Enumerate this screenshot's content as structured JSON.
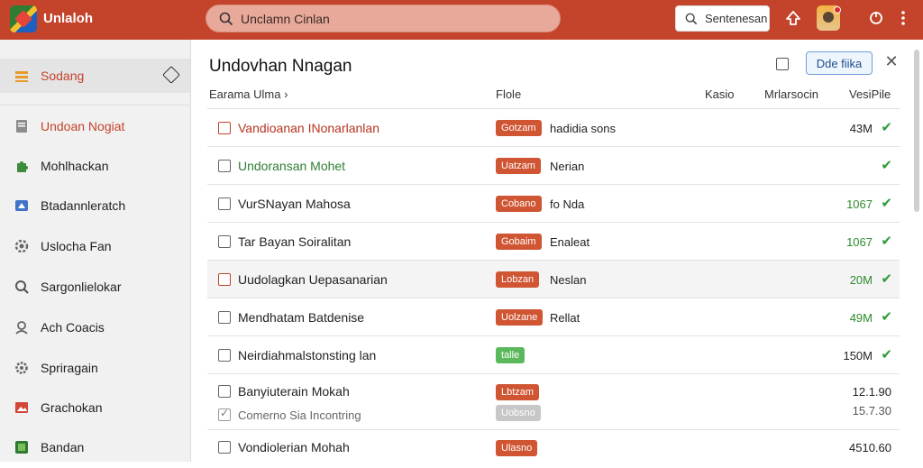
{
  "header": {
    "app_title": "Unlaloh",
    "search_placeholder": "Unclamn Cinlan",
    "action_button_label": "Sentenesan",
    "colors": {
      "topbar": "#c3432b",
      "accent": "#c3432b",
      "success": "#2e9b3a"
    }
  },
  "sidebar": {
    "items": [
      {
        "label": "Sodang",
        "icon": "layers-icon"
      },
      {
        "label": "Undoan Nogiat",
        "icon": "document-icon"
      },
      {
        "label": "Mohlhackan",
        "icon": "puzzle-icon"
      },
      {
        "label": "Btadannleratch",
        "icon": "drive-icon"
      },
      {
        "label": "Uslocha Fan",
        "icon": "settings-icon"
      },
      {
        "label": "Sargonlielokar",
        "icon": "search-icon"
      },
      {
        "label": "Ach Coacis",
        "icon": "user-icon"
      },
      {
        "label": "Spriragain",
        "icon": "gear-icon"
      },
      {
        "label": "Grachokan",
        "icon": "image-icon"
      },
      {
        "label": "Bandan",
        "icon": "app-icon"
      }
    ]
  },
  "main": {
    "title": "Undovhan Nnagan",
    "primary_button_label": "Dde fiika",
    "columns": {
      "name": "Earama Ulma",
      "file": "Flole",
      "kasio": "Kasio",
      "mrlarsocin": "Mrlarsocin",
      "size": "VesiPile"
    },
    "rows": [
      {
        "name": "Vandioanan INonarlanlan",
        "badge": "Gotzam",
        "detail": "hadidia sons",
        "size": "43M",
        "checked": true
      },
      {
        "name": "Undoransan Mohet",
        "badge": "Uatzam",
        "detail": "Nerian",
        "size": "",
        "checked": true
      },
      {
        "name": "VurSNayan Mahosa",
        "badge": "Cobano",
        "detail": "fo Nda",
        "size": "1067",
        "checked": true
      },
      {
        "name": "Tar Bayan Soiralitan",
        "badge": "Gobaim",
        "detail": "Enaleat",
        "size": "1067",
        "checked": true
      },
      {
        "name": "Uudolagkan Uepasanarian",
        "badge": "Lobzan",
        "detail": "Neslan",
        "size": "20M",
        "checked": true
      },
      {
        "name": "Mendhatam Batdenise",
        "badge": "Uolzane",
        "detail": "Rellat",
        "size": "49M",
        "checked": true
      },
      {
        "name": "Neirdiahmalstonsting lan",
        "badge": "talle",
        "detail": "",
        "size": "150M",
        "checked": true
      },
      {
        "name": "Banyiuterain Mokah",
        "badge": "Lbtzam",
        "detail": "",
        "size": "12.1.90"
      },
      {
        "name": "Comerno Sia Incontring",
        "badge": "Uobsno",
        "detail": "",
        "size": "15.7.30"
      },
      {
        "name": "Vondiolerian Mohah",
        "badge": "Ulasno",
        "detail": "",
        "size": "4510.60"
      }
    ]
  }
}
